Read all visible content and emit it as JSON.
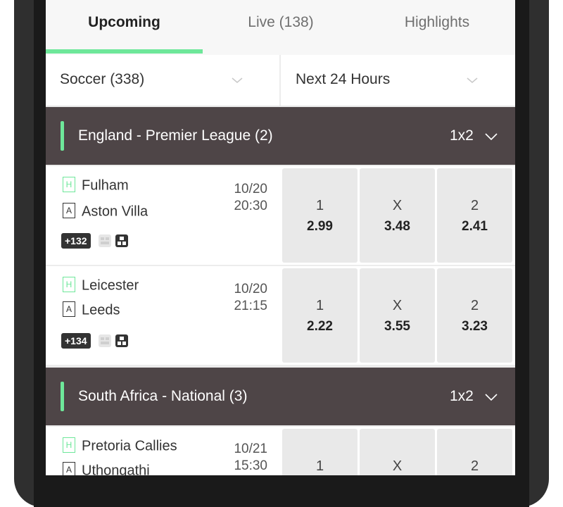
{
  "tabs": [
    {
      "label": "Upcoming",
      "active": true
    },
    {
      "label": "Live (138)"
    },
    {
      "label": "Highlights"
    }
  ],
  "filters": {
    "sport": "Soccer (338)",
    "timeframe": "Next 24 Hours"
  },
  "colors": {
    "accent": "#6ee79a",
    "league_header": "#4e4547",
    "odds_cell": "#e9e9e9"
  },
  "leagues": [
    {
      "name": "England - Premier League (2)",
      "market": "1x2",
      "matches": [
        {
          "home_tag": "H",
          "home": "Fulham",
          "away_tag": "A",
          "away": "Aston Villa",
          "date": "10/20",
          "time": "20:30",
          "markets_badge": "+132",
          "odds": [
            {
              "label": "1",
              "value": "2.99"
            },
            {
              "label": "X",
              "value": "3.48"
            },
            {
              "label": "2",
              "value": "2.41"
            }
          ]
        },
        {
          "home_tag": "H",
          "home": "Leicester",
          "away_tag": "A",
          "away": "Leeds",
          "date": "10/20",
          "time": "21:15",
          "markets_badge": "+134",
          "odds": [
            {
              "label": "1",
              "value": "2.22"
            },
            {
              "label": "X",
              "value": "3.55"
            },
            {
              "label": "2",
              "value": "3.23"
            }
          ]
        }
      ]
    },
    {
      "name": "South Africa - National (3)",
      "market": "1x2",
      "matches": [
        {
          "home_tag": "H",
          "home": "Pretoria Callies",
          "away_tag": "A",
          "away": "Uthongathi",
          "date": "10/21",
          "time": "15:30",
          "odds": [
            {
              "label": "1"
            },
            {
              "label": "X"
            },
            {
              "label": "2"
            }
          ]
        }
      ]
    }
  ]
}
